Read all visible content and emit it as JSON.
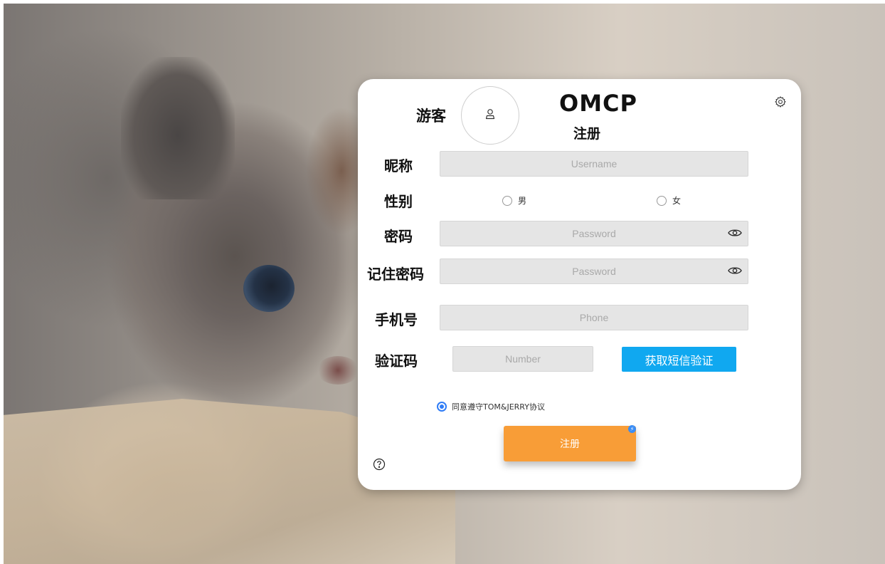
{
  "header": {
    "guest_label": "游客",
    "app_title": "OMCP",
    "page_subtitle": "注册",
    "avatar_icon": "user-icon",
    "settings_icon": "gear-icon"
  },
  "form": {
    "nickname": {
      "label": "昵称",
      "placeholder": "Username",
      "value": ""
    },
    "gender": {
      "label": "性别",
      "options": [
        "男",
        "女"
      ],
      "selected": null
    },
    "password": {
      "label": "密码",
      "placeholder": "Password",
      "value": "",
      "toggle_icon": "eye-icon"
    },
    "confirm_password": {
      "label": "记住密码",
      "placeholder": "Password",
      "value": "",
      "toggle_icon": "eye-icon"
    },
    "phone": {
      "label": "手机号",
      "placeholder": "Phone",
      "value": ""
    },
    "verify_code": {
      "label": "验证码",
      "placeholder": "Number",
      "value": "",
      "sms_button": "获取短信验证"
    },
    "agreement": {
      "text": "同意遵守TOM&JERRY协议",
      "checked": true
    },
    "submit_label": "注册"
  },
  "footer": {
    "help_icon": "question-circle-icon"
  },
  "colors": {
    "sms_button": "#10a8f0",
    "submit_button": "#f89d37",
    "radio_accent": "#2f7cf6"
  }
}
